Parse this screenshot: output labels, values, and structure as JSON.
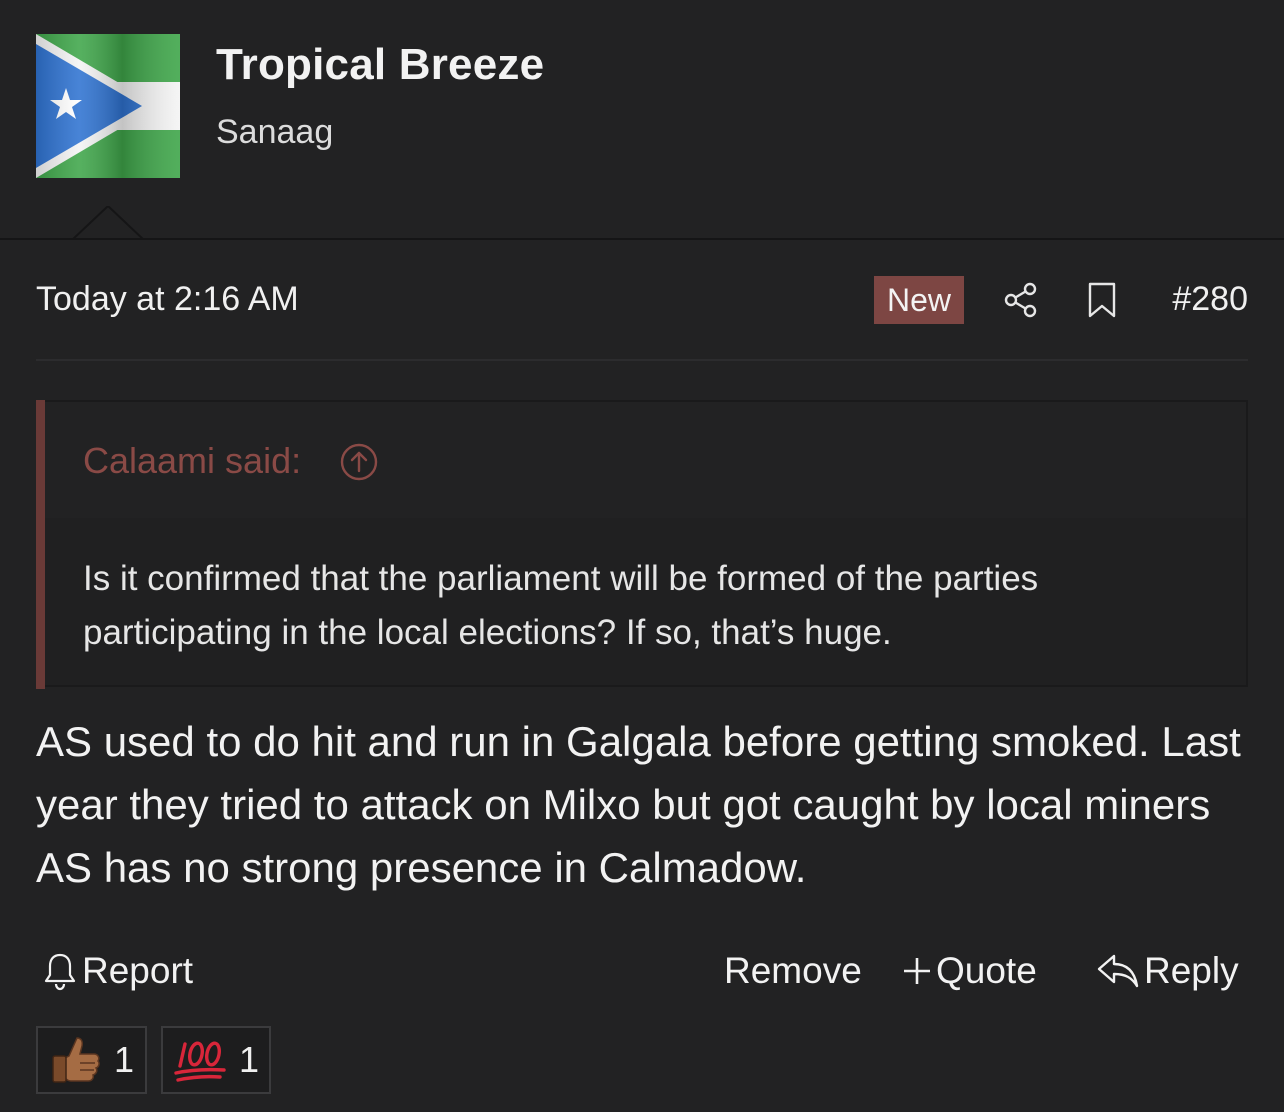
{
  "user": {
    "name": "Tropical Breeze",
    "title": "Sanaag",
    "avatar_icon": "flag-avatar-icon"
  },
  "post": {
    "date": "Today at 2:16 AM",
    "new_label": "New",
    "number": "#280",
    "quote": {
      "author": "Calaami said:",
      "text": "Is it confirmed that the parliament will be formed of the parties participating in the local elections? If so, that’s huge."
    },
    "body": "AS used to do hit and run in Galgala before getting smoked. Last year they tried to attack on Milxo but got caught by local miners AS has no strong presence in Calmadow."
  },
  "actions": {
    "report": "Report",
    "remove": "Remove",
    "quote": "Quote",
    "reply": "Reply"
  },
  "reactions": [
    {
      "icon": "thumbs-up-icon",
      "count": "1"
    },
    {
      "icon": "hundred-points-icon",
      "count": "1"
    }
  ],
  "colors": {
    "background": "#222223",
    "accent": "#7d4643",
    "quote_author": "#8a4a46",
    "text": "#f2f2f2"
  }
}
